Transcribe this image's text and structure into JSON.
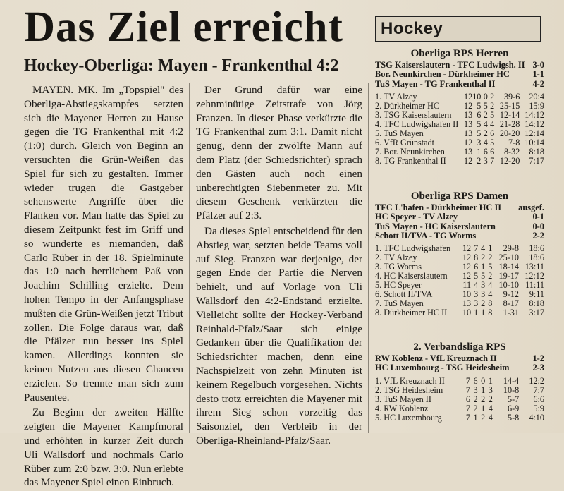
{
  "headline": "Das Ziel erreicht",
  "subhead": "Hockey-Oberliga: Mayen - Frankenthal 4:2",
  "col1": [
    "MAYEN. MK. Im „Topspiel\" des Oberliga-Abstiegskampfes setzten sich die Mayener Herren zu Hause gegen die TG Frankenthal mit 4:2 (1:0) durch. Gleich von Beginn an versuchten die Grün-Weißen das Spiel für sich zu gestalten. Immer wieder trugen die Gastgeber sehenswerte Angriffe über die Flanken vor. Man hatte das Spiel zu diesem Zeitpunkt fest im Griff und so wunderte es niemanden, daß Carlo Rüber in der 18. Spielminute das 1:0 nach herrlichem Paß von Joachim Schilling erzielte. Dem hohen Tempo in der Anfangsphase mußten die Grün-Weißen jetzt Tribut zollen. Die Folge daraus war, daß die Pfälzer nun besser ins Spiel kamen. Allerdings konnten sie keinen Nutzen aus diesen Chancen erzielen. So trennte man sich zum Pausentee.",
    "Zu Beginn der zweiten Hälfte zeigten die Mayener Kampfmoral und erhöhten in kurzer Zeit durch Uli Wallsdorf und nochmals Carlo Rüber zum 2:0 bzw. 3:0. Nun erlebte das Mayener Spiel einen Einbruch."
  ],
  "col2": [
    "Der Grund dafür war eine zehnminütige Zeitstrafe von Jörg Franzen. In dieser Phase verkürzte die TG Frankenthal zum 3:1. Damit nicht genug, denn der zwölfte Mann auf dem Platz (der Schiedsrichter) sprach den Gästen auch noch einen unberechtigten Siebenmeter zu. Mit diesem Geschenk verkürzten die Pfälzer auf 2:3.",
    "Da dieses Spiel entscheidend für den Abstieg war, setzten beide Teams voll auf Sieg. Franzen war derjenige, der gegen Ende der Partie die Nerven behielt, und auf Vorlage von Uli Wallsdorf den 4:2-Endstand erzielte. Vielleicht sollte der Hockey-Verband Reinhald-Pfalz/Saar sich einige Gedanken über die Qualifikation der Schiedsrichter machen, denn eine Nachspielzeit von zehn Minuten ist keinem Regelbuch vorgesehen. Nichts desto trotz erreichten die Mayener mit ihrem Sieg schon vorzeitig das Saisonziel, den Verbleib in der Oberliga-Rheinland-Pfalz/Saar."
  ],
  "section_label": "Hockey",
  "herren": {
    "title": "Oberliga RPS Herren",
    "results": [
      {
        "match": "TSG Kaiserslautern - TFC Ludwigsh. II",
        "score": "3-0"
      },
      {
        "match": "Bor. Neunkirchen - Dürkheimer HC",
        "score": "1-1"
      },
      {
        "match": "TuS Mayen - TG Frankenthal II",
        "score": "4-2"
      }
    ],
    "table": [
      {
        "team": "1. TV Alzey",
        "sp": "12",
        "s": "10",
        "u": "0",
        "n": "2",
        "goals": "39-6",
        "pts": "20:4"
      },
      {
        "team": "2. Dürkheimer HC",
        "sp": "12",
        "s": "5",
        "u": "5",
        "n": "2",
        "goals": "25-15",
        "pts": "15:9"
      },
      {
        "team": "3. TSG Kaiserslautern",
        "sp": "13",
        "s": "6",
        "u": "2",
        "n": "5",
        "goals": "12-14",
        "pts": "14:12"
      },
      {
        "team": "4. TFC Ludwigshafen II",
        "sp": "13",
        "s": "5",
        "u": "4",
        "n": "4",
        "goals": "21-28",
        "pts": "14:12"
      },
      {
        "team": "5. TuS Mayen",
        "sp": "13",
        "s": "5",
        "u": "2",
        "n": "6",
        "goals": "20-20",
        "pts": "12:14"
      },
      {
        "team": "6. VfR Grünstadt",
        "sp": "12",
        "s": "3",
        "u": "4",
        "n": "5",
        "goals": "7-8",
        "pts": "10:14"
      },
      {
        "team": "7. Bor. Neunkirchen",
        "sp": "13",
        "s": "1",
        "u": "6",
        "n": "6",
        "goals": "8-32",
        "pts": "8:18"
      },
      {
        "team": "8. TG Frankenthal II",
        "sp": "12",
        "s": "2",
        "u": "3",
        "n": "7",
        "goals": "12-20",
        "pts": "7:17"
      }
    ]
  },
  "damen": {
    "title": "Oberliga RPS Damen",
    "results": [
      {
        "match": "TFC L'hafen - Dürkheimer HC II",
        "score": "ausgef."
      },
      {
        "match": "HC Speyer - TV Alzey",
        "score": "0-1"
      },
      {
        "match": "TuS Mayen - HC Kaiserslautern",
        "score": "0-0"
      },
      {
        "match": "Schott II/TVA - TG Worms",
        "score": "2-2"
      }
    ],
    "table": [
      {
        "team": "1. TFC Ludwigshafen",
        "sp": "12",
        "s": "7",
        "u": "4",
        "n": "1",
        "goals": "29-8",
        "pts": "18:6"
      },
      {
        "team": "2. TV Alzey",
        "sp": "12",
        "s": "8",
        "u": "2",
        "n": "2",
        "goals": "25-10",
        "pts": "18:6"
      },
      {
        "team": "3. TG Worms",
        "sp": "12",
        "s": "6",
        "u": "1",
        "n": "5",
        "goals": "18-14",
        "pts": "13:11"
      },
      {
        "team": "4. HC Kaiserslautern",
        "sp": "12",
        "s": "5",
        "u": "5",
        "n": "2",
        "goals": "19-17",
        "pts": "12:12"
      },
      {
        "team": "5. HC Speyer",
        "sp": "11",
        "s": "4",
        "u": "3",
        "n": "4",
        "goals": "10-10",
        "pts": "11:11"
      },
      {
        "team": "6. Schott II/TVA",
        "sp": "10",
        "s": "3",
        "u": "3",
        "n": "4",
        "goals": "9-12",
        "pts": "9:11"
      },
      {
        "team": "7. TuS Mayen",
        "sp": "13",
        "s": "3",
        "u": "2",
        "n": "8",
        "goals": "8-17",
        "pts": "8:18"
      },
      {
        "team": "8. Dürkheimer HC II",
        "sp": "10",
        "s": "1",
        "u": "1",
        "n": "8",
        "goals": "1-31",
        "pts": "3:17"
      }
    ]
  },
  "verbandsliga": {
    "title": "2. Verbandsliga RPS",
    "results": [
      {
        "match": "RW Koblenz - VfL Kreuznach II",
        "score": "1-2"
      },
      {
        "match": "HC Luxembourg - TSG Heidesheim",
        "score": "2-3"
      }
    ],
    "table": [
      {
        "team": "1. VfL Kreuznach II",
        "sp": "7",
        "s": "6",
        "u": "0",
        "n": "1",
        "goals": "14-4",
        "pts": "12:2"
      },
      {
        "team": "2. TSG Heidesheim",
        "sp": "7",
        "s": "3",
        "u": "1",
        "n": "3",
        "goals": "10-8",
        "pts": "7:7"
      },
      {
        "team": "3. TuS Mayen II",
        "sp": "6",
        "s": "2",
        "u": "2",
        "n": "2",
        "goals": "5-7",
        "pts": "6:6"
      },
      {
        "team": "4. RW Koblenz",
        "sp": "7",
        "s": "2",
        "u": "1",
        "n": "4",
        "goals": "6-9",
        "pts": "5:9"
      },
      {
        "team": "5. HC Luxembourg",
        "sp": "7",
        "s": "1",
        "u": "2",
        "n": "4",
        "goals": "5-8",
        "pts": "4:10"
      }
    ]
  }
}
